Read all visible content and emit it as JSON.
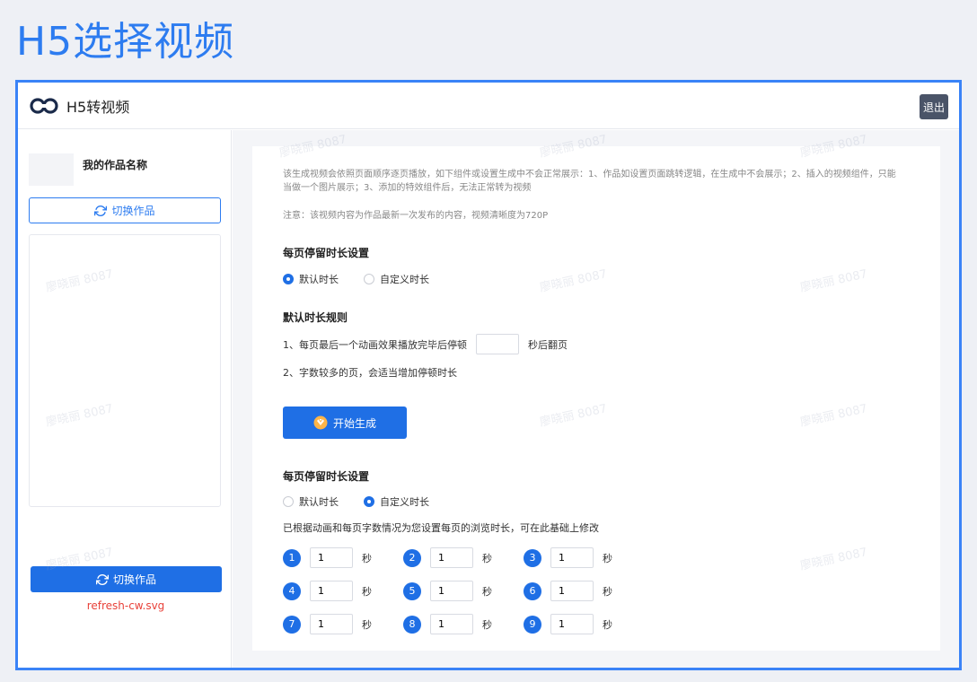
{
  "page_heading": "H5选择视频",
  "header": {
    "brand_title": "H5转视频",
    "logout_label": "退出"
  },
  "sidebar": {
    "work_name": "我的作品名称",
    "switch_outline_label": "切换作品",
    "switch_solid_label": "切换作品",
    "svg_note": "refresh-cw.svg"
  },
  "main": {
    "intro": "该生成视频会依照页面顺序逐页播放，如下组件或设置生成中不会正常展示：1、作品如设置页面跳转逻辑，在生成中不会展示；2、插入的视频组件，只能当做一个图片展示；3、添加的特效组件后，无法正常转为视频",
    "notice": "注意：该视频内容为作品最新一次发布的内容，视频清晰度为720P",
    "section1": {
      "title": "每页停留时长设置",
      "option_default": "默认时长",
      "option_custom": "自定义时长"
    },
    "rules": {
      "title": "默认时长规则",
      "rule1_prefix": "1、每页最后一个动画效果播放完毕后停顿",
      "rule1_value": "",
      "rule1_suffix": "秒后翻页",
      "rule2": "2、字数较多的页，会适当增加停顿时长"
    },
    "start_label": "开始生成",
    "section2": {
      "title": "每页停留时长设置",
      "option_default": "默认时长",
      "option_custom": "自定义时长",
      "hint": "已根据动画和每页字数情况为您设置每页的浏览时长，可在此基础上修改"
    },
    "pages": [
      {
        "num": "1",
        "value": "1",
        "unit": "秒"
      },
      {
        "num": "2",
        "value": "1",
        "unit": "秒"
      },
      {
        "num": "3",
        "value": "1",
        "unit": "秒"
      },
      {
        "num": "4",
        "value": "1",
        "unit": "秒"
      },
      {
        "num": "5",
        "value": "1",
        "unit": "秒"
      },
      {
        "num": "6",
        "value": "1",
        "unit": "秒"
      },
      {
        "num": "7",
        "value": "1",
        "unit": "秒"
      },
      {
        "num": "8",
        "value": "1",
        "unit": "秒"
      },
      {
        "num": "9",
        "value": "1",
        "unit": "秒"
      }
    ]
  },
  "watermark_text": "廖晓丽 8087",
  "colors": {
    "accent": "#1f6fe5",
    "heading": "#2d7cf0",
    "frame": "#3a83f7",
    "note": "#e8423a"
  }
}
